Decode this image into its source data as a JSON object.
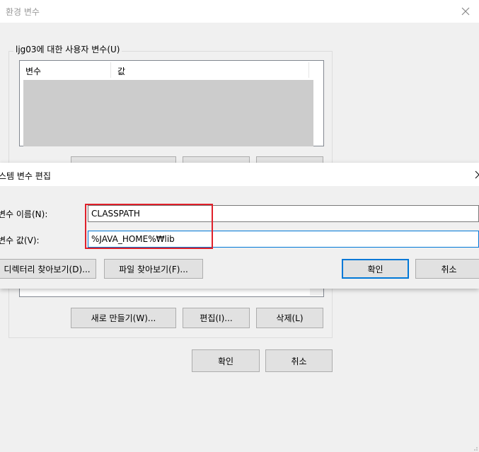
{
  "env_window": {
    "title": "환경 변수",
    "user_group_label": "ljg03에 대한 사용자 변수(U)",
    "columns": [
      "변수",
      "값"
    ],
    "buttons": {
      "new": "새로 만들기(W)...",
      "edit": "편집(I)...",
      "delete": "삭제(L)"
    },
    "ok": "확인",
    "cancel": "취소"
  },
  "edit_dialog": {
    "title": "스템 변수 편집",
    "name_label": "변수 이름(N):",
    "name_value": "CLASSPATH",
    "value_label": "변수 값(V):",
    "value_value": "%JAVA_HOME%₩lib",
    "browse_dir": "디렉터리 찾아보기(D)...",
    "browse_file": "파일 찾아보기(F)...",
    "ok": "확인",
    "cancel": "취소"
  },
  "colors": {
    "highlight": "#e0202a",
    "accent": "#0078d7"
  }
}
